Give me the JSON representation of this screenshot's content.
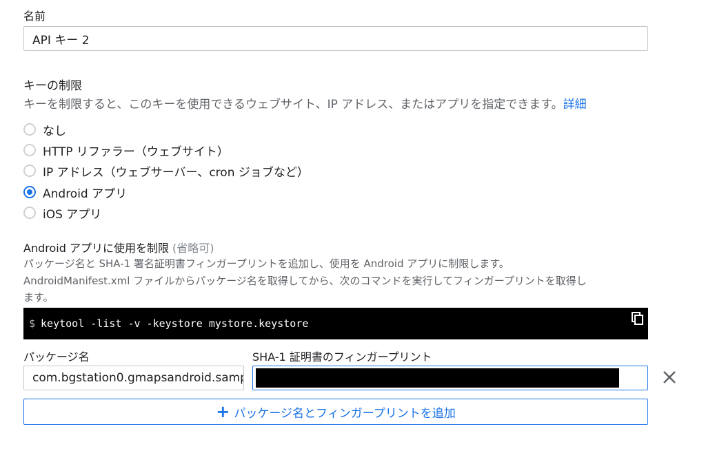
{
  "name_section": {
    "label": "名前",
    "value": "API キー 2"
  },
  "restrictions": {
    "title": "キーの制限",
    "description": "キーを制限すると、このキーを使用できるウェブサイト、IP アドレス、またはアプリを指定できます。",
    "details_link": "詳細",
    "options": [
      {
        "label": "なし",
        "checked": false
      },
      {
        "label": "HTTP リファラー（ウェブサイト）",
        "checked": false
      },
      {
        "label": "IP アドレス（ウェブサーバー、cron ジョブなど）",
        "checked": false
      },
      {
        "label": "Android アプリ",
        "checked": true
      },
      {
        "label": "iOS アプリ",
        "checked": false
      }
    ]
  },
  "android_section": {
    "title": "Android アプリに使用を制限",
    "optional": "(省略可)",
    "help_line1": "パッケージ名と SHA-1 署名証明書フィンガープリントを追加し、使用を Android アプリに制限します。",
    "help_line2": "AndroidManifest.xml ファイルからパッケージ名を取得してから、次のコマンドを実行してフィンガープリントを取得し",
    "help_line3": "ます。",
    "command_prompt": "$",
    "command": "keytool -list -v -keystore mystore.keystore",
    "package_label": "パッケージ名",
    "fingerprint_label": "SHA-1 証明書のフィンガープリント",
    "package_value": "com.bgstation0.gmapsandroid.samp",
    "add_button_label": "パッケージ名とフィンガープリントを追加"
  },
  "colors": {
    "accent": "#1a73e8",
    "text": "#202124",
    "muted": "#5f6368"
  }
}
